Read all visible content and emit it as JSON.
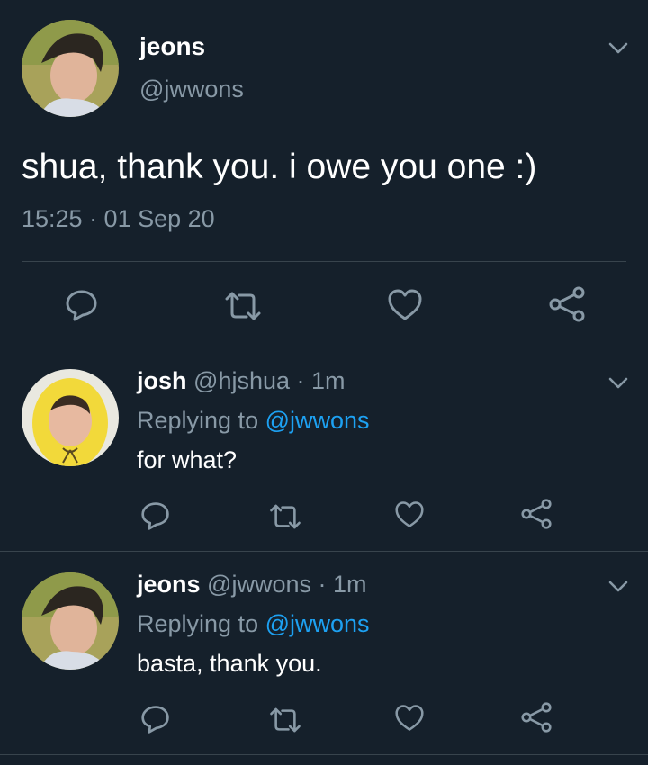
{
  "main_tweet": {
    "display_name": "jeons",
    "handle": "@jwwons",
    "text": "shua, thank you. i owe you one :)",
    "timestamp": "15:25 · 01 Sep 20"
  },
  "replies": [
    {
      "display_name": "josh",
      "handle": "@hjshua",
      "age": "· 1m",
      "replying_prefix": "Replying to",
      "replying_to": "@jwwons",
      "text": "for what?"
    },
    {
      "display_name": "jeons",
      "handle": "@jwwons",
      "age": "· 1m",
      "replying_prefix": "Replying to",
      "replying_to": "@jwwons",
      "text": "basta, thank you."
    }
  ],
  "icons": {
    "reply": "reply-icon",
    "retweet": "retweet-icon",
    "like": "like-icon",
    "share": "share-icon",
    "menu": "chevron-down-icon"
  },
  "colors": {
    "background": "#15202b",
    "text": "#ffffff",
    "muted": "#8899a6",
    "link": "#1da1f2",
    "divider": "#38444d"
  }
}
